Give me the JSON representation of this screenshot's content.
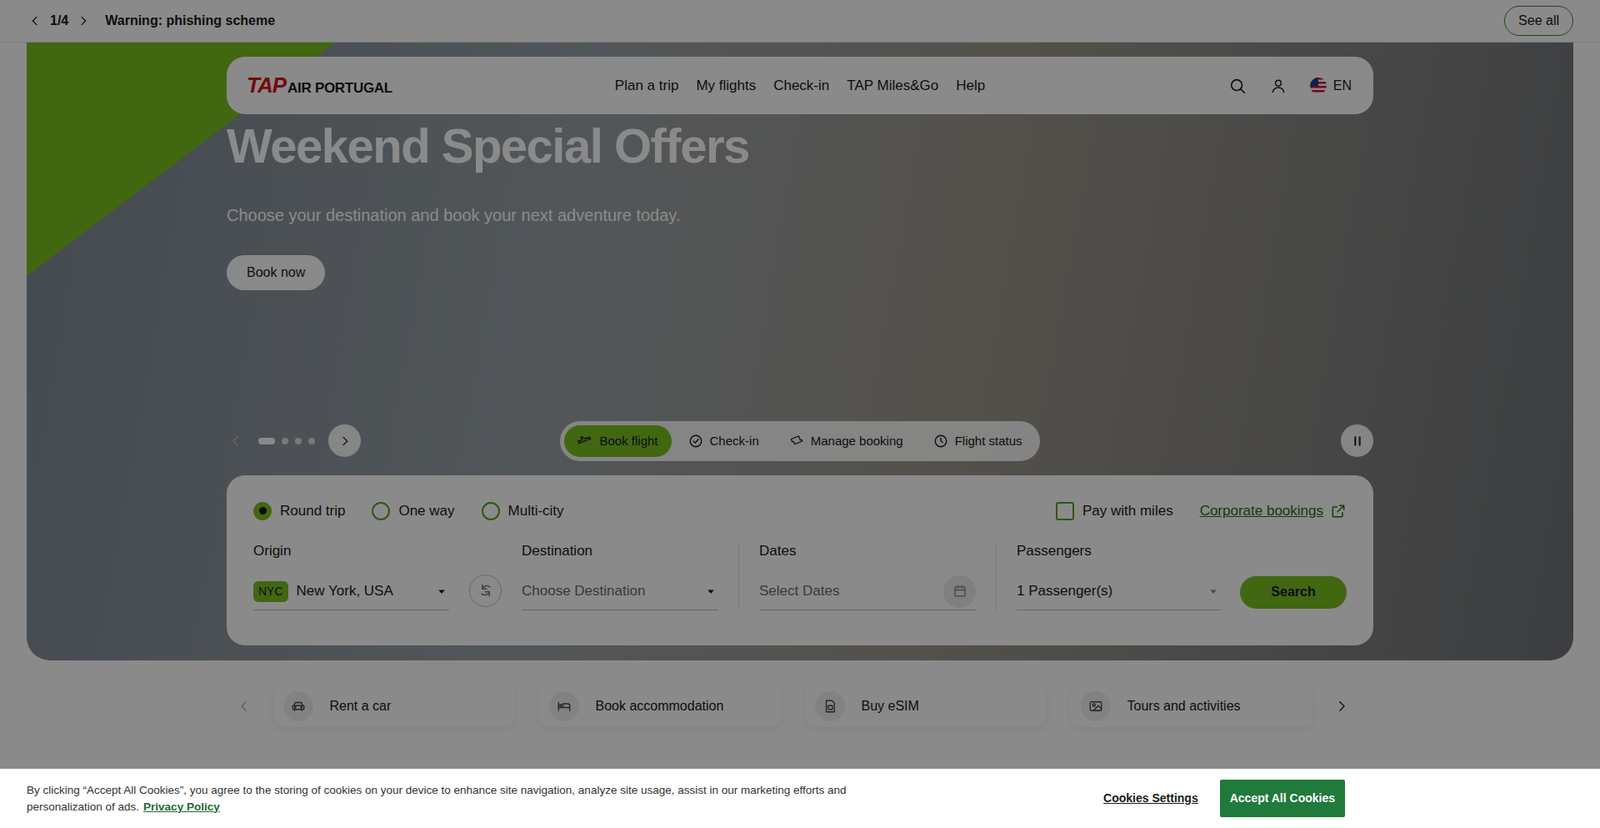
{
  "notice": {
    "counter": "1/4",
    "title": "Warning: phishing scheme",
    "see_all": "See all"
  },
  "brand": {
    "mark": "TAP",
    "name": "AIR PORTUGAL"
  },
  "nav": {
    "items": [
      "Plan a trip",
      "My flights",
      "Check-in",
      "TAP Miles&Go",
      "Help"
    ],
    "language": "EN"
  },
  "hero": {
    "title": "Weekend Special Offers",
    "subtitle": "Choose your destination and book your next adventure today.",
    "cta": "Book now",
    "carousel": {
      "prev_enabled": false,
      "playing": true,
      "slides": [
        {
          "selected": true
        },
        {
          "selected": false
        },
        {
          "selected": false
        },
        {
          "selected": false
        }
      ]
    }
  },
  "booking": {
    "tabs": [
      {
        "label": "Book flight",
        "selected": true
      },
      {
        "label": "Check-in",
        "selected": false
      },
      {
        "label": "Manage booking",
        "selected": false
      },
      {
        "label": "Flight status",
        "selected": false
      }
    ],
    "trip_types": [
      {
        "label": "Round trip",
        "selected": true
      },
      {
        "label": "One way",
        "selected": false
      },
      {
        "label": "Multi-city",
        "selected": false
      }
    ],
    "pay_with_miles": {
      "label": "Pay with miles",
      "checked": false
    },
    "corporate": "Corporate bookings",
    "origin": {
      "label": "Origin",
      "code": "NYC",
      "value": "New York, USA"
    },
    "destination": {
      "label": "Destination",
      "placeholder": "Choose Destination"
    },
    "dates": {
      "label": "Dates",
      "placeholder": "Select Dates"
    },
    "passengers": {
      "label": "Passengers",
      "value": "1 Passenger(s)"
    },
    "search": "Search"
  },
  "services": {
    "prev_enabled": false,
    "items": [
      "Rent a car",
      "Book accommodation",
      "Buy eSIM",
      "Tours and activities"
    ]
  },
  "cookies": {
    "text": "By clicking “Accept All Cookies”, you agree to the storing of cookies on your device to enhance site navigation, analyze site usage, assist in our marketing efforts and personalization of ads.",
    "privacy": "Privacy Policy",
    "settings": "Cookies Settings",
    "accept": "Accept All Cookies"
  }
}
